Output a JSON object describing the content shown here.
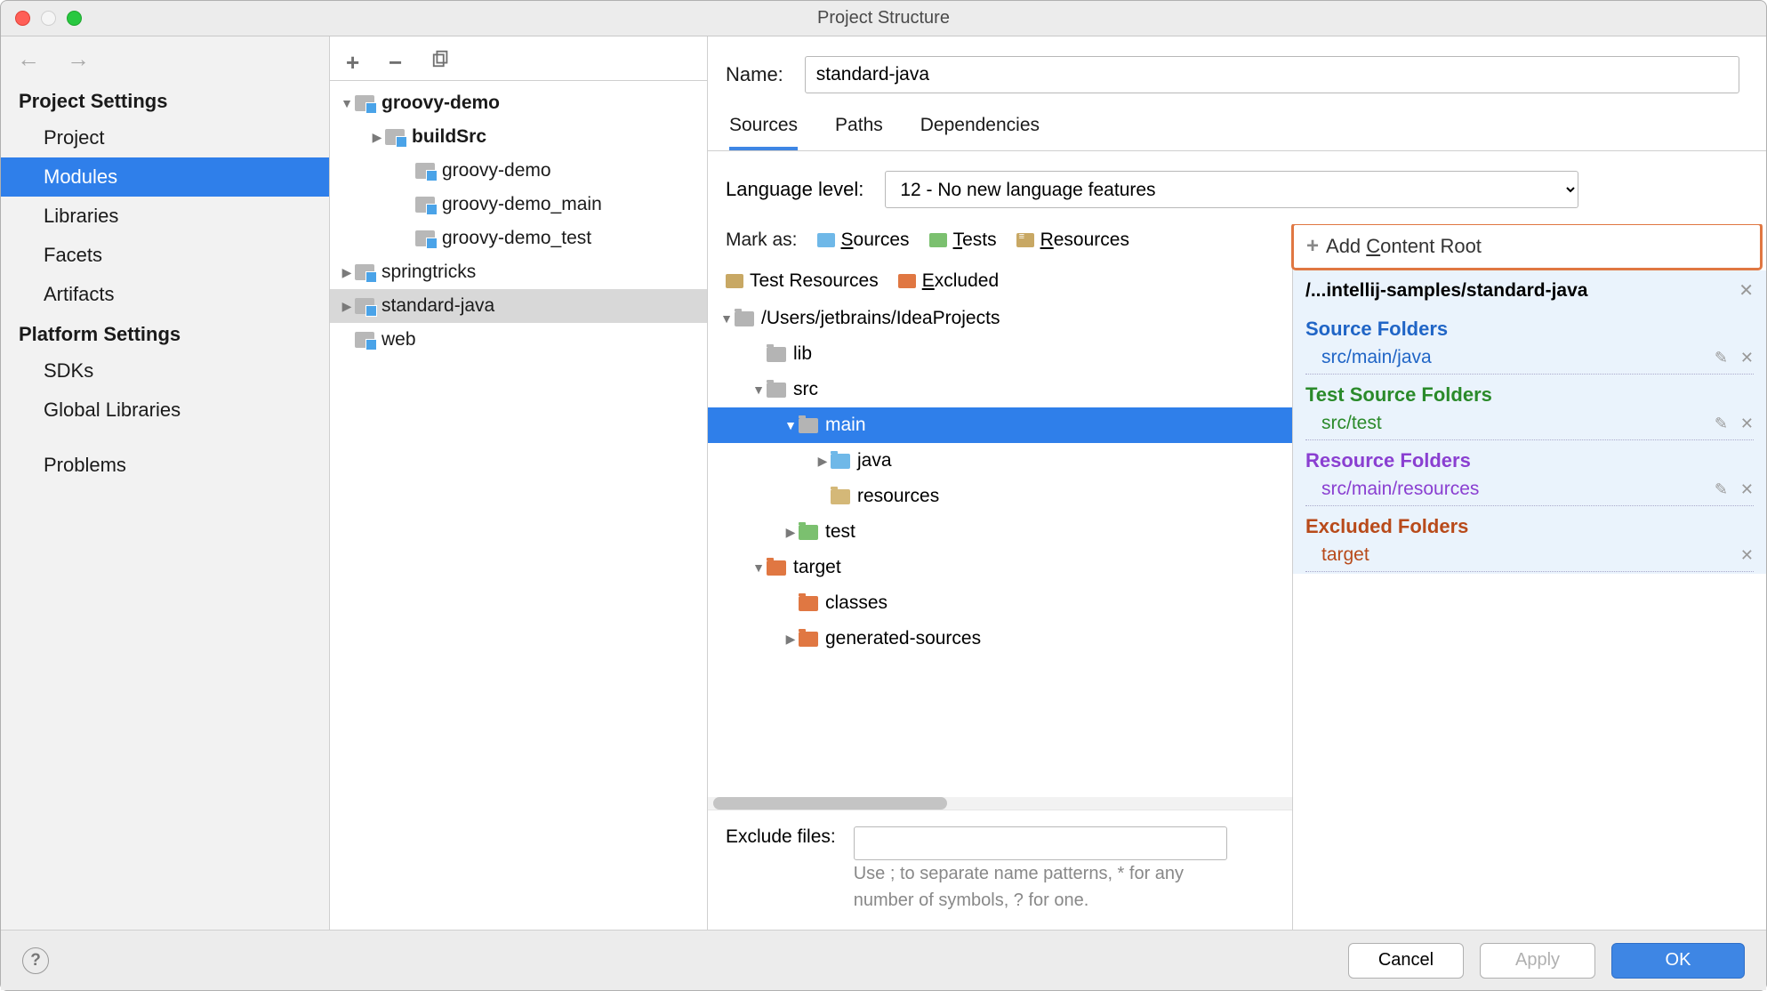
{
  "title": "Project Structure",
  "sidebar": {
    "h1": "Project Settings",
    "items1": [
      "Project",
      "Modules",
      "Libraries",
      "Facets",
      "Artifacts"
    ],
    "h2": "Platform Settings",
    "items2": [
      "SDKs",
      "Global Libraries"
    ],
    "problems": "Problems"
  },
  "modules": [
    {
      "name": "groovy-demo",
      "depth": 0,
      "bold": true,
      "arrow": "▼",
      "icon": "mod"
    },
    {
      "name": "buildSrc",
      "depth": 1,
      "bold": true,
      "arrow": "▶",
      "icon": "mod"
    },
    {
      "name": "groovy-demo",
      "depth": 2,
      "icon": "mod"
    },
    {
      "name": "groovy-demo_main",
      "depth": 2,
      "icon": "mod"
    },
    {
      "name": "groovy-demo_test",
      "depth": 2,
      "icon": "mod"
    },
    {
      "name": "springtricks",
      "depth": 0,
      "arrow": "▶",
      "icon": "mod"
    },
    {
      "name": "standard-java",
      "depth": 0,
      "arrow": "▶",
      "icon": "mod",
      "sel": true
    },
    {
      "name": "web",
      "depth": 0,
      "icon": "mod"
    }
  ],
  "name_label": "Name:",
  "name_value": "standard-java",
  "tabs": [
    "Sources",
    "Paths",
    "Dependencies"
  ],
  "lang_label": "Language level:",
  "lang_value": "12 - No new language features",
  "mark_label": "Mark as:",
  "marks": [
    {
      "label": "Sources",
      "u": "S",
      "rest": "ources",
      "cls": "c-src"
    },
    {
      "label": "Tests",
      "u": "T",
      "rest": "ests",
      "cls": "c-tst"
    },
    {
      "label": "Resources",
      "u": "R",
      "rest": "esources",
      "cls": "c-res"
    },
    {
      "label": "Test Resources",
      "u": "",
      "rest": "Test Resources",
      "cls": "c-trs"
    },
    {
      "label": "Excluded",
      "u": "E",
      "rest": "xcluded",
      "cls": "c-exc"
    }
  ],
  "srctree": [
    {
      "name": "/Users/jetbrains/IdeaProjects",
      "depth": 0,
      "arrow": "▼",
      "cls": "f-gray"
    },
    {
      "name": "lib",
      "depth": 1,
      "cls": "f-gray"
    },
    {
      "name": "src",
      "depth": 1,
      "arrow": "▼",
      "cls": "f-gray"
    },
    {
      "name": "main",
      "depth": 2,
      "arrow": "▼",
      "cls": "f-gray",
      "sel": true
    },
    {
      "name": "java",
      "depth": 3,
      "arrow": "▶",
      "cls": "f-blue"
    },
    {
      "name": "resources",
      "depth": 3,
      "cls": "f-res"
    },
    {
      "name": "test",
      "depth": 2,
      "arrow": "▶",
      "cls": "f-green"
    },
    {
      "name": "target",
      "depth": 1,
      "arrow": "▼",
      "cls": "f-orange"
    },
    {
      "name": "classes",
      "depth": 2,
      "cls": "f-orange"
    },
    {
      "name": "generated-sources",
      "depth": 2,
      "arrow": "▶",
      "cls": "f-orange"
    }
  ],
  "exclude_label": "Exclude files:",
  "exclude_hint": "Use ; to separate name patterns, * for any number of symbols, ? for one.",
  "add_root": "Add Content Root",
  "root_path": "/...intellij-samples/standard-java",
  "groups": [
    {
      "title": "Source Folders",
      "hcls": "h-src",
      "ecls": "e-src",
      "entries": [
        "src/main/java"
      ],
      "edit": true
    },
    {
      "title": "Test Source Folders",
      "hcls": "h-tst",
      "ecls": "e-tst",
      "entries": [
        "src/test"
      ],
      "edit": true
    },
    {
      "title": "Resource Folders",
      "hcls": "h-res",
      "ecls": "e-res",
      "entries": [
        "src/main/resources"
      ],
      "edit": true
    },
    {
      "title": "Excluded Folders",
      "hcls": "h-exc",
      "ecls": "e-exc",
      "entries": [
        "target"
      ],
      "edit": false
    }
  ],
  "buttons": {
    "cancel": "Cancel",
    "apply": "Apply",
    "ok": "OK"
  }
}
